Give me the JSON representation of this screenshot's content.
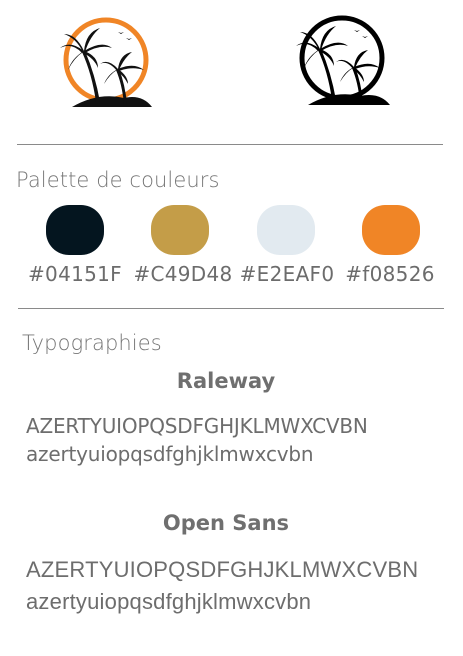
{
  "palette": {
    "title": "Palette de couleurs",
    "colors": [
      {
        "hex": "#04151F",
        "label": "#04151F"
      },
      {
        "hex": "#C49D48",
        "label": "#C49D48"
      },
      {
        "hex": "#E2EAF0",
        "label": "#E2EAF0"
      },
      {
        "hex": "#f08526",
        "label": "#f08526"
      }
    ]
  },
  "logos": {
    "color_version": {
      "ring_color": "#f08526",
      "icon": "palm-island-icon"
    },
    "mono_version": {
      "ring_color": "#000000",
      "icon": "palm-island-icon"
    }
  },
  "typography": {
    "title": "Typographies",
    "fonts": [
      {
        "name": "Raleway",
        "uppercase": "AZERTYUIOPQSDFGHJKLMWXCVBN",
        "lowercase": "azertyuiopqsdfghjklmwxcvbn"
      },
      {
        "name": "Open Sans",
        "uppercase": "AZERTYUIOPQSDFGHJKLMWXCVBN",
        "lowercase": "azertyuiopqsdfghjklmwxcvbn"
      }
    ]
  }
}
